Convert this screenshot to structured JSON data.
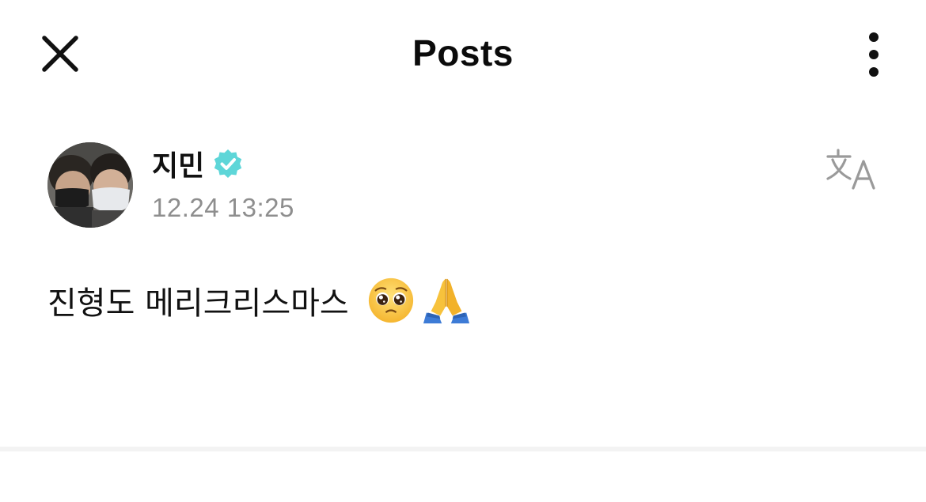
{
  "header": {
    "title": "Posts",
    "close_icon": "close-icon",
    "more_icon": "more-vertical-icon"
  },
  "post": {
    "author": "지민",
    "verified_icon": "verified-badge-icon",
    "timestamp": "12.24 13:25",
    "translate_icon": "translate-icon",
    "text": "진형도 메리크리스마스",
    "emojis": [
      "pleading-face-emoji",
      "folded-hands-emoji"
    ]
  },
  "colors": {
    "verified": "#5ed6d8",
    "timestamp": "#8e8e8e",
    "translate_icon": "#9a9a9a",
    "divider": "#f3f3f3"
  }
}
